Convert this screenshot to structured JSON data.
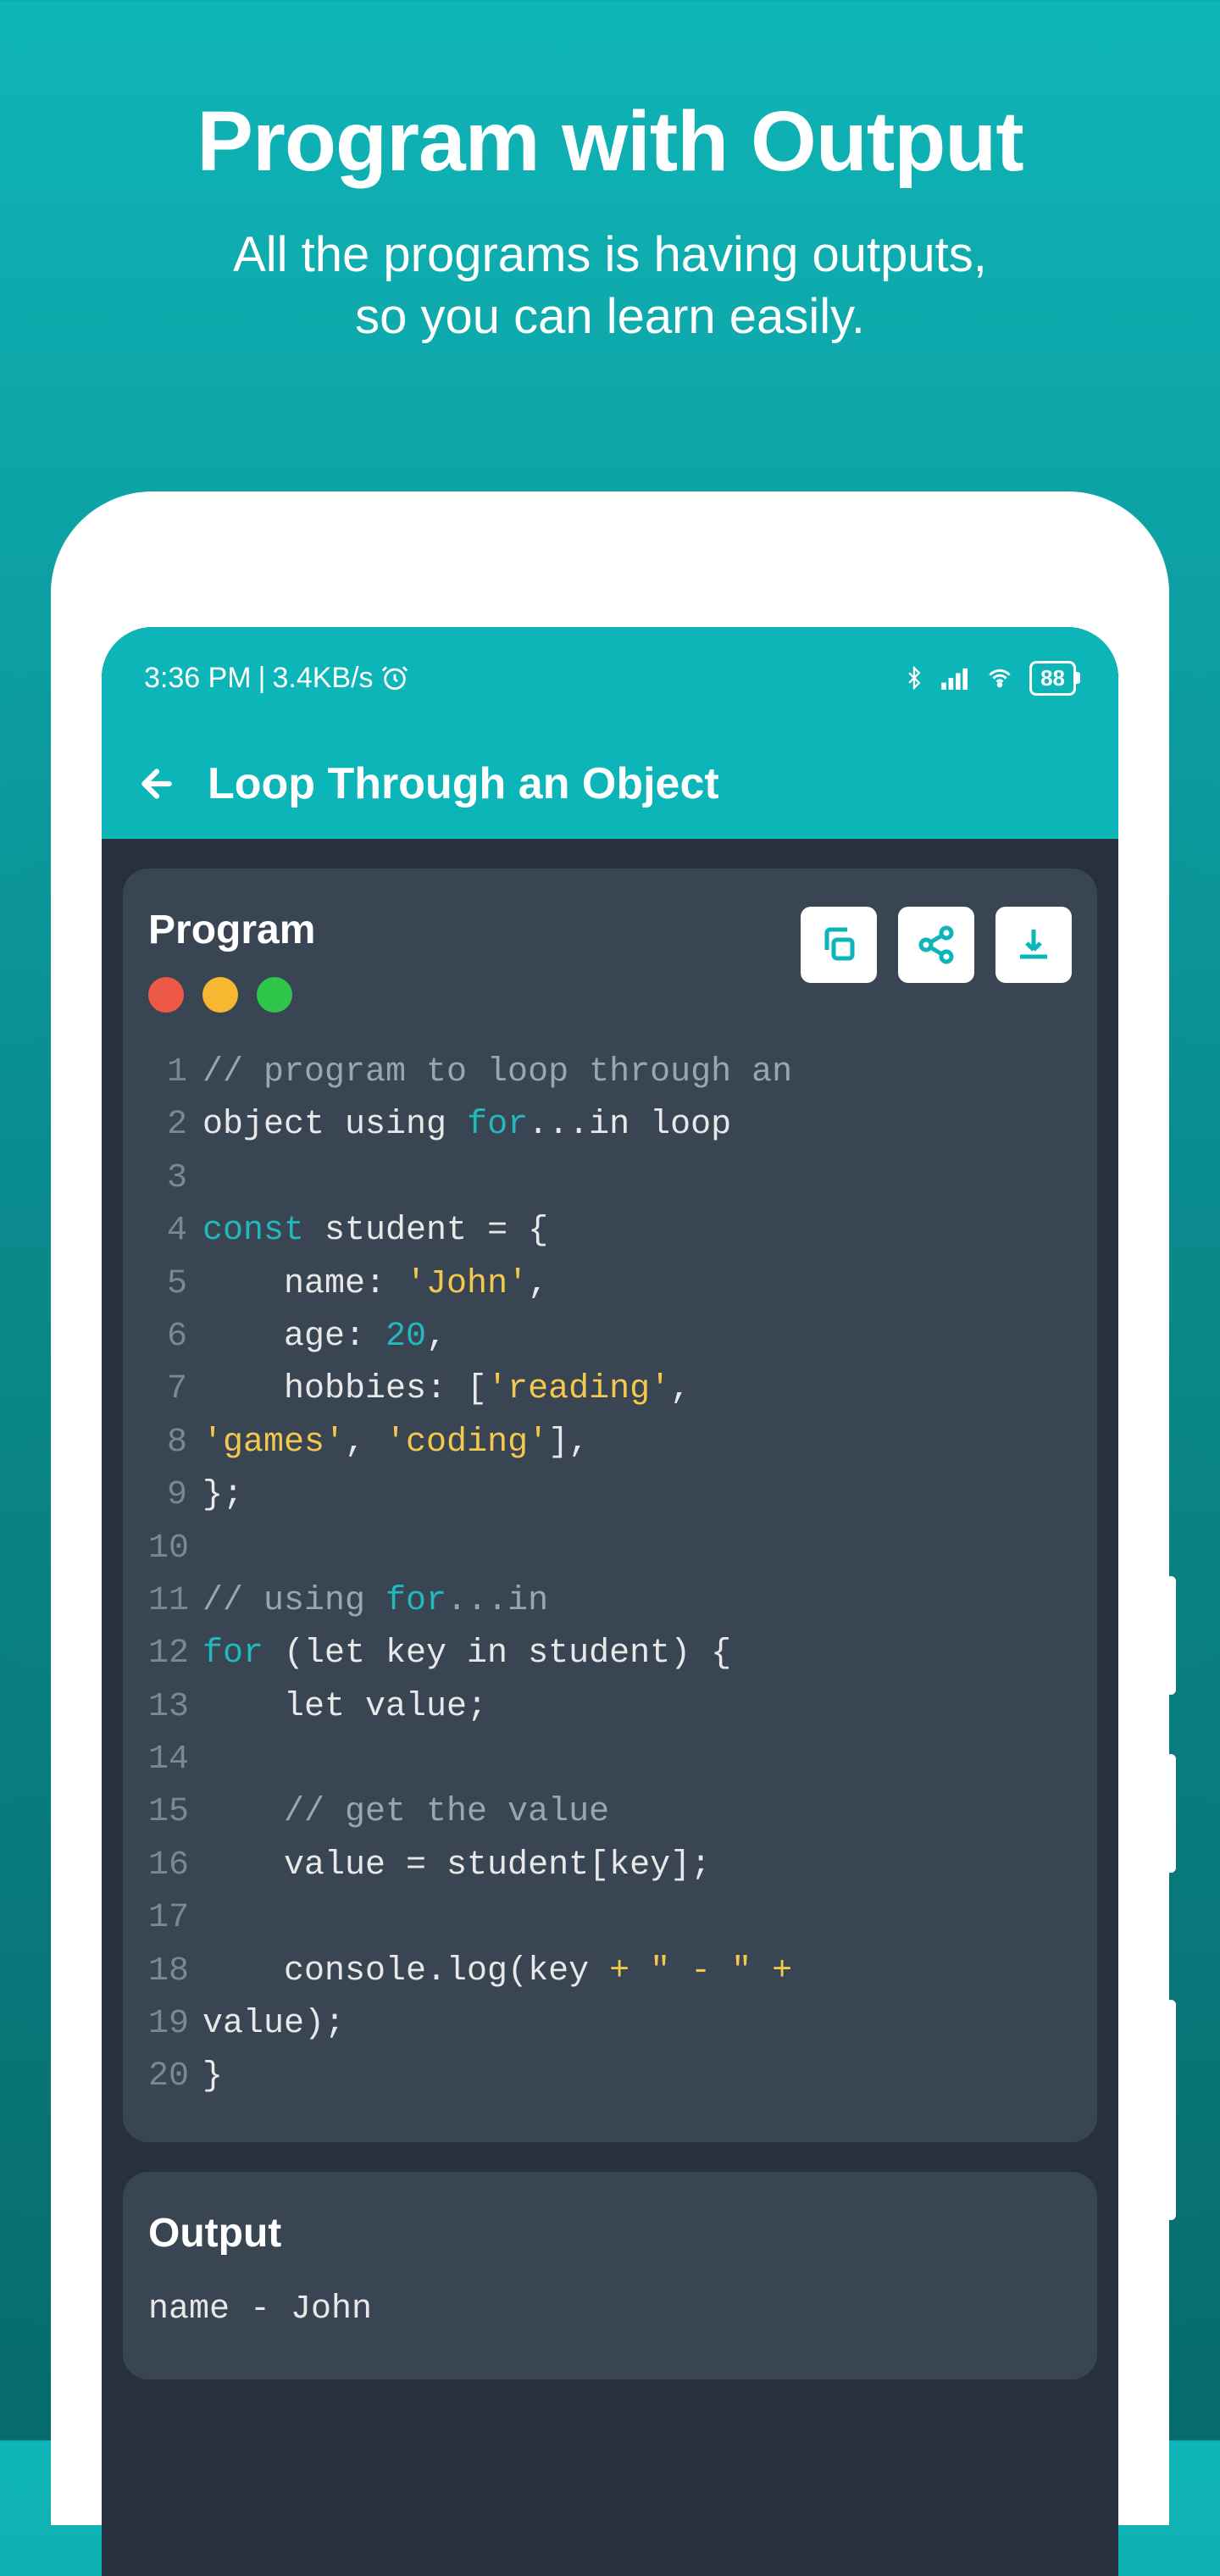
{
  "promo": {
    "title": "Program with Output",
    "subtitle_line1": "All the programs is having outputs,",
    "subtitle_line2": "so you can learn easily."
  },
  "status": {
    "time": "3:36 PM",
    "speed": "3.4KB/s",
    "battery": "88"
  },
  "appbar": {
    "title": "Loop Through an Object"
  },
  "program": {
    "label": "Program",
    "code": {
      "l1_comment": "// program to loop through an",
      "l2a": "object using ",
      "l2_kw": "for",
      "l2b": "...in loop",
      "l4_kw": "const",
      "l4_rest": " student = {",
      "l5a": "    name: ",
      "l5_str": "'John'",
      "l5b": ",",
      "l6a": "    age: ",
      "l6_num": "20",
      "l6b": ",",
      "l7a": "    hobbies: [",
      "l7_str": "'reading'",
      "l7b": ",",
      "l8_str1": "'games'",
      "l8a": ", ",
      "l8_str2": "'coding'",
      "l8b": "],",
      "l9": "};",
      "l11a": "// using ",
      "l11_kw": "for",
      "l11b": "...in",
      "l12_kw": "for",
      "l12_rest": " (let key in student) {",
      "l13": "    let value;",
      "l15": "    // get the value",
      "l16": "    value = student[key];",
      "l18a": "    console.log(key ",
      "l18_op1": "+",
      "l18_str": " \" - \" ",
      "l18_op2": "+",
      "l19": "value);",
      "l20": "}"
    }
  },
  "output": {
    "label": "Output",
    "line1": "name - John"
  }
}
